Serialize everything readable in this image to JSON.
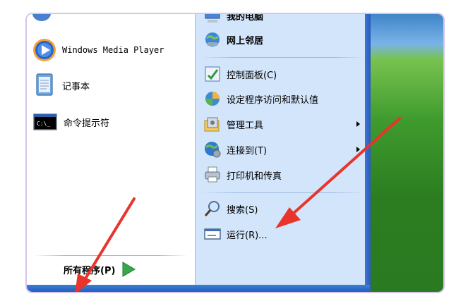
{
  "left_pane": {
    "items": [
      {
        "label": "Windows Media Player",
        "icon": "windows-media-player-icon"
      },
      {
        "label": "记事本",
        "icon": "notepad-icon"
      },
      {
        "label": "命令提示符",
        "icon": "command-prompt-icon",
        "icon_text": "C:\\_"
      }
    ],
    "all_programs": "所有程序(P)"
  },
  "right_pane": {
    "items": [
      {
        "label": "我的电脑",
        "icon": "my-computer-icon"
      },
      {
        "label": "网上邻居",
        "icon": "network-places-icon"
      },
      {
        "label": "控制面板(C)",
        "icon": "control-panel-icon"
      },
      {
        "label": "设定程序访问和默认值",
        "icon": "set-program-access-icon"
      },
      {
        "label": "管理工具",
        "icon": "admin-tools-icon"
      },
      {
        "label": "连接到(T)",
        "icon": "connect-to-icon"
      },
      {
        "label": "打印机和传真",
        "icon": "printers-icon"
      },
      {
        "label": "搜索(S)",
        "icon": "search-icon"
      },
      {
        "label": "运行(R)...",
        "icon": "run-icon"
      }
    ]
  },
  "colors": {
    "right_pane_bg": "#d3e5fa",
    "annotation_arrow": "#e8342b",
    "taskbar_blue": "#245ebe"
  }
}
